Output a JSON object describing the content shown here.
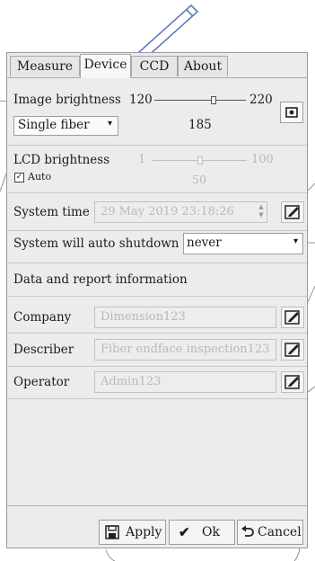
{
  "tabs": [
    "Measure",
    "Device",
    "CCD",
    "About"
  ],
  "active_tab": "Device",
  "image_brightness": {
    "label": "Image brightness",
    "min": "120",
    "max": "220",
    "value": "185",
    "mode": "Single fiber"
  },
  "lcd_brightness": {
    "label": "LCD brightness",
    "min": "1",
    "max": "100",
    "value": "50",
    "auto_label": "Auto",
    "auto_checked": true
  },
  "system_time": {
    "label": "System time",
    "value": "29 May 2019 23:18:26"
  },
  "auto_shutdown": {
    "label": "System will auto shutdown",
    "value": "never"
  },
  "report_section": {
    "title": "Data and report information",
    "fields": [
      {
        "label": "Company",
        "value": "Dimension123"
      },
      {
        "label": "Describer",
        "value": "Fiber endface inspection123"
      },
      {
        "label": "Operator",
        "value": "Admin123"
      }
    ]
  },
  "buttons": {
    "apply": "Apply",
    "ok": "Ok",
    "cancel": "Cancel"
  },
  "colors": {
    "panel_bg": "#ececec",
    "border": "#9a9a9a",
    "disabled_text": "#b8b8b8",
    "pen_stroke": "#5b7fbf"
  }
}
